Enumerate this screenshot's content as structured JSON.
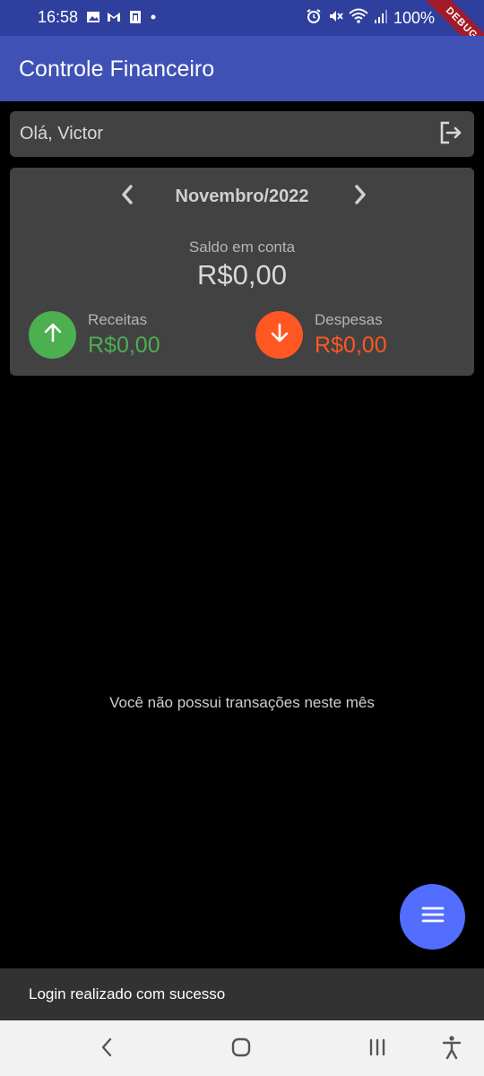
{
  "status_bar": {
    "time": "16:58",
    "battery": "100%",
    "debug_banner": "DEBUG",
    "left_icons": [
      "image-icon",
      "gmail-icon",
      "clipboard-icon",
      "dot-icon"
    ],
    "right_icons": [
      "alarm-icon",
      "mute-icon",
      "wifi-icon",
      "signal-icon"
    ]
  },
  "app_bar": {
    "title": "Controle Financeiro"
  },
  "greeting": {
    "text": "Olá, Victor",
    "logout_icon": "logout-icon"
  },
  "summary": {
    "month": "Novembro/2022",
    "balance_label": "Saldo em conta",
    "balance_value": "R$0,00",
    "income_label": "Receitas",
    "income_value": "R$0,00",
    "expense_label": "Despesas",
    "expense_value": "R$0,00",
    "colors": {
      "income": "#4caf50",
      "expense": "#ff5722"
    }
  },
  "empty_state": {
    "message": "Você não possui transações neste mês"
  },
  "fab": {
    "icon": "menu-icon",
    "color": "#536dfe"
  },
  "snackbar": {
    "message": "Login realizado com sucesso"
  },
  "nav_bar": {
    "buttons": [
      "back-icon",
      "home-icon",
      "recents-icon",
      "accessibility-icon"
    ]
  },
  "theme": {
    "primary": "#3f51b5",
    "status_bar": "#2f3f9e",
    "card": "#424242",
    "background": "#000000"
  }
}
